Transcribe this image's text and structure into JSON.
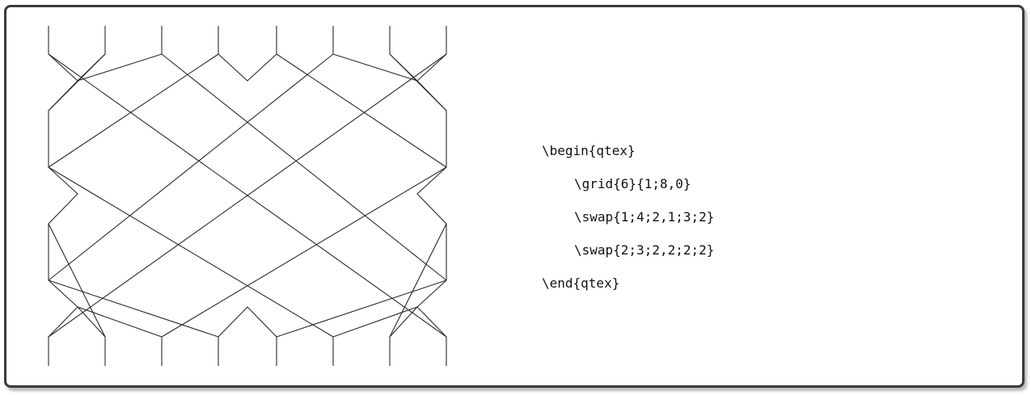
{
  "code_sample": {
    "lines": [
      {
        "text": "\\begin{qtex}",
        "indent": false
      },
      {
        "text": "\\grid{6}{1;8,0}",
        "indent": true
      },
      {
        "text": "\\swap{1;4;2,1;3;2}",
        "indent": true
      },
      {
        "text": "\\swap{2;3;2,2;2;2}",
        "indent": true
      },
      {
        "text": "\\end{qtex}",
        "indent": false
      }
    ]
  },
  "diagram": {
    "wire_count": 8,
    "line_color": "#2b2b2b",
    "border_color": "#3a3a3a"
  }
}
